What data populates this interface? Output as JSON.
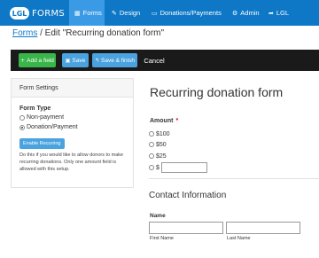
{
  "nav": {
    "logo_badge": "LGL",
    "logo_text": "FORMS",
    "tabs": [
      {
        "label": "Forms",
        "icon": "grid-icon"
      },
      {
        "label": "Design",
        "icon": "pencil-icon"
      },
      {
        "label": "Donations/Payments",
        "icon": "card-icon"
      },
      {
        "label": "Admin",
        "icon": "gear-icon"
      },
      {
        "label": "LGL",
        "icon": "share-arrow-icon"
      }
    ]
  },
  "breadcrumb": {
    "link": "Forms",
    "current": " / Edit \"Recurring donation form\""
  },
  "toolbar": {
    "add_field": "Add a field",
    "save": "Save",
    "save_finish": "Save & finish",
    "cancel": "Cancel"
  },
  "settings": {
    "header": "Form Settings",
    "form_type_label": "Form Type",
    "options": [
      "Non-payment",
      "Donation/Payment"
    ],
    "selected": "Donation/Payment",
    "enable_button": "Enable Recurring",
    "help": "Do this if you would like to allow donors to make recurring donations. Only one amount field is allowed with this setup."
  },
  "form": {
    "title": "Recurring donation form",
    "amount_label": "Amount",
    "required_marker": "*",
    "amount_options": [
      "$100",
      "$50",
      "$25"
    ],
    "other_prefix": "$",
    "section_title": "Contact Information",
    "name_label": "Name",
    "first_name": "First Name",
    "last_name": "Last Name"
  },
  "colors": {
    "nav": "#0f78c6",
    "nav_active": "#3a9ae6",
    "toolbar": "#1a1a1a",
    "add_button": "#39b54a",
    "save_button": "#4aa3df"
  }
}
